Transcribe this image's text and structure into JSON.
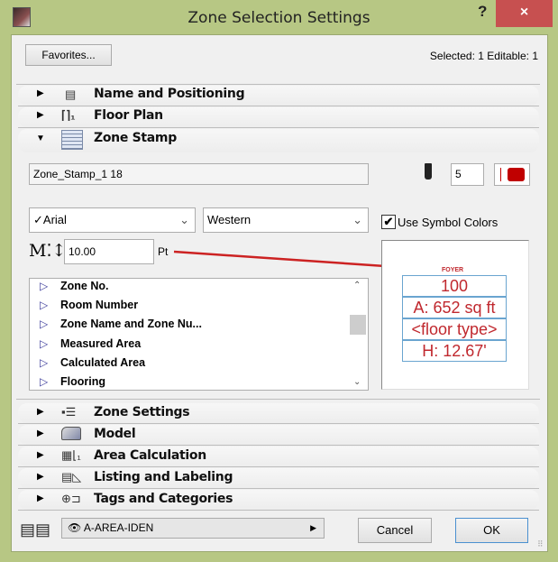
{
  "window": {
    "title": "Zone Selection Settings",
    "help": "?",
    "close": "×"
  },
  "header": {
    "favorites_label": "Favorites...",
    "selection_status": "Selected: 1 Editable: 1"
  },
  "panels_top": [
    {
      "label": "Name and Positioning",
      "icon": "name-positioning-icon",
      "expanded": false
    },
    {
      "label": "Floor Plan",
      "icon": "floor-plan-icon",
      "expanded": false
    },
    {
      "label": "Zone Stamp",
      "icon": "zone-stamp-icon",
      "expanded": true
    }
  ],
  "zone_stamp": {
    "stamp_name": "Zone_Stamp_1 18",
    "pen_number": "5",
    "pen_color": "#c00000",
    "font": "Arial",
    "font_check": "✓",
    "script": "Western",
    "use_symbol_colors_label": "Use Symbol Colors",
    "use_symbol_colors": true,
    "text_size": "10.00",
    "text_unit": "Pt",
    "items": [
      "Zone No.",
      "Room Number",
      "Zone Name and Zone Nu...",
      "Measured Area",
      "Calculated Area",
      "Flooring"
    ],
    "preview": {
      "name": "FOYER",
      "number": "100",
      "area": "A: 652 sq ft",
      "floor": "<floor type>",
      "height": "H: 12.67'",
      "text_color": "#c0282e",
      "annotation_color": "#cc2222"
    }
  },
  "panels_bottom": [
    {
      "label": "Zone Settings",
      "icon": "zone-settings-icon"
    },
    {
      "label": "Model",
      "icon": "model-icon"
    },
    {
      "label": "Area Calculation",
      "icon": "area-calculation-icon"
    },
    {
      "label": "Listing and Labeling",
      "icon": "listing-labeling-icon"
    },
    {
      "label": "Tags and Categories",
      "icon": "tags-categories-icon"
    }
  ],
  "footer": {
    "layer": "A-AREA-IDEN",
    "cancel_label": "Cancel",
    "ok_label": "OK"
  }
}
